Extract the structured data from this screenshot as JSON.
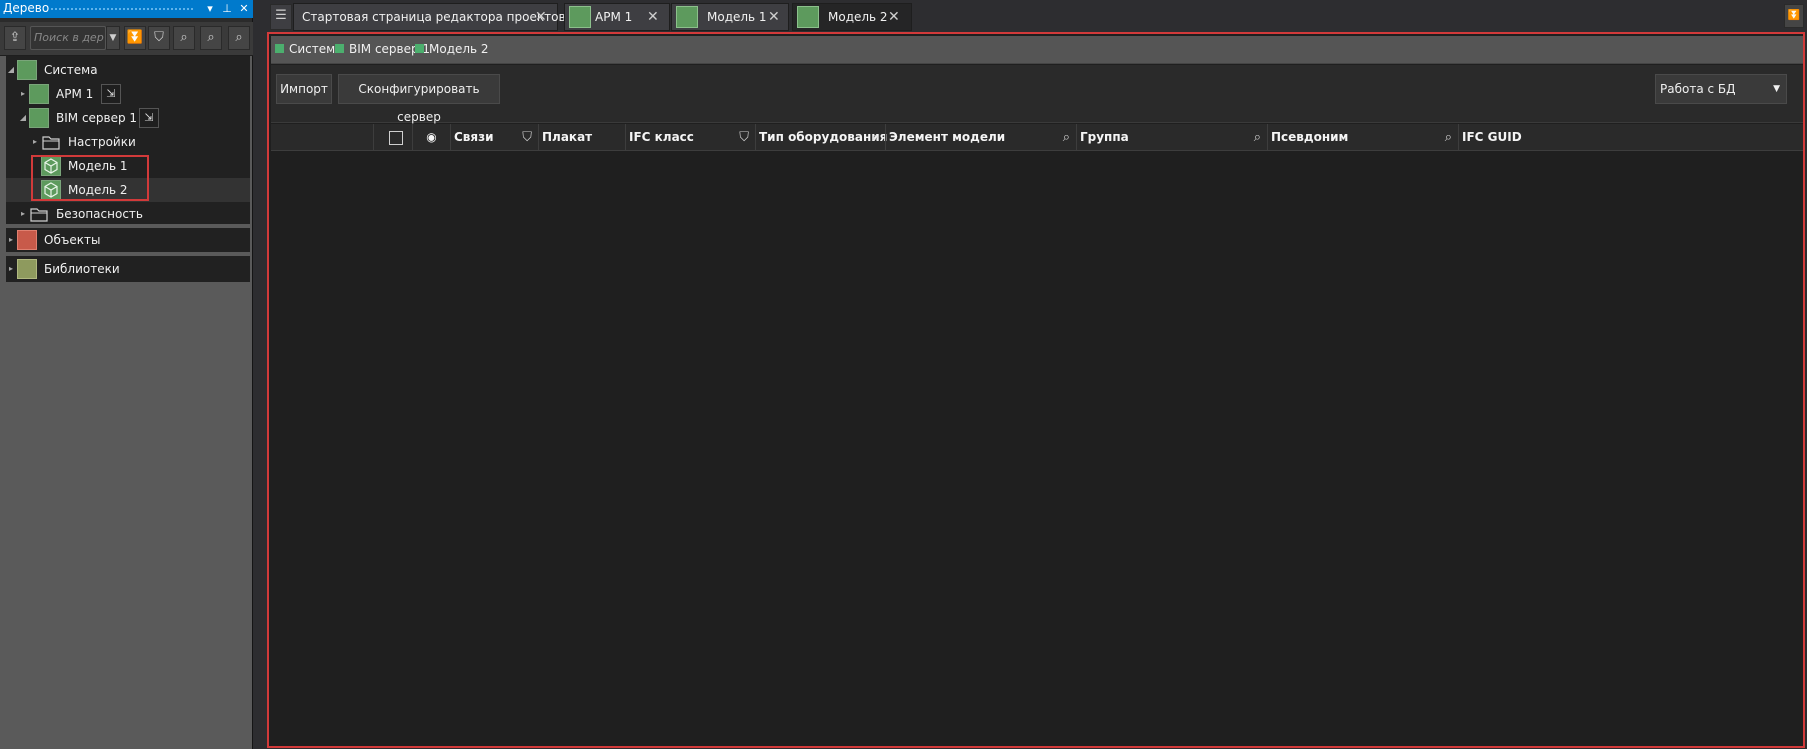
{
  "panel": {
    "title": "Дерево",
    "search_placeholder": "Поиск в дер",
    "header_buttons": [
      "dropdown",
      "pin",
      "close"
    ]
  },
  "tree": {
    "system_label": "Система",
    "arm1_label": "АРМ 1",
    "bim_label": "BIM сервер 1",
    "settings_label": "Настройки",
    "model1_label": "Модель 1",
    "model2_label": "Модель 2",
    "security_label": "Безопасность",
    "objects_label": "Объекты",
    "libraries_label": "Библиотеки"
  },
  "tabs": {
    "start": "Стартовая страница редактора проектов",
    "arm1": "АРМ 1",
    "model1": "Модель 1",
    "model2": "Модель 2"
  },
  "breadcrumb": {
    "system": "Система",
    "bim": "BIM сервер 1",
    "model": "Модель 2"
  },
  "actions": {
    "import_label": "Импорт",
    "configure_label": "Сконфигурировать сервер",
    "db_select_value": "Работа с БД"
  },
  "grid": {
    "columns": {
      "links": "Связи",
      "poster": "Плакат",
      "ifc_class": "IFC класс",
      "equipment_type": "Тип оборудования",
      "model_element": "Элемент модели",
      "group": "Группа",
      "alias": "Псевдоним",
      "ifc_guid": "IFC GUID"
    }
  },
  "colors": {
    "accent": "#007acc",
    "highlight_border": "#d23a3a",
    "node_green": "#5d9a5d"
  }
}
